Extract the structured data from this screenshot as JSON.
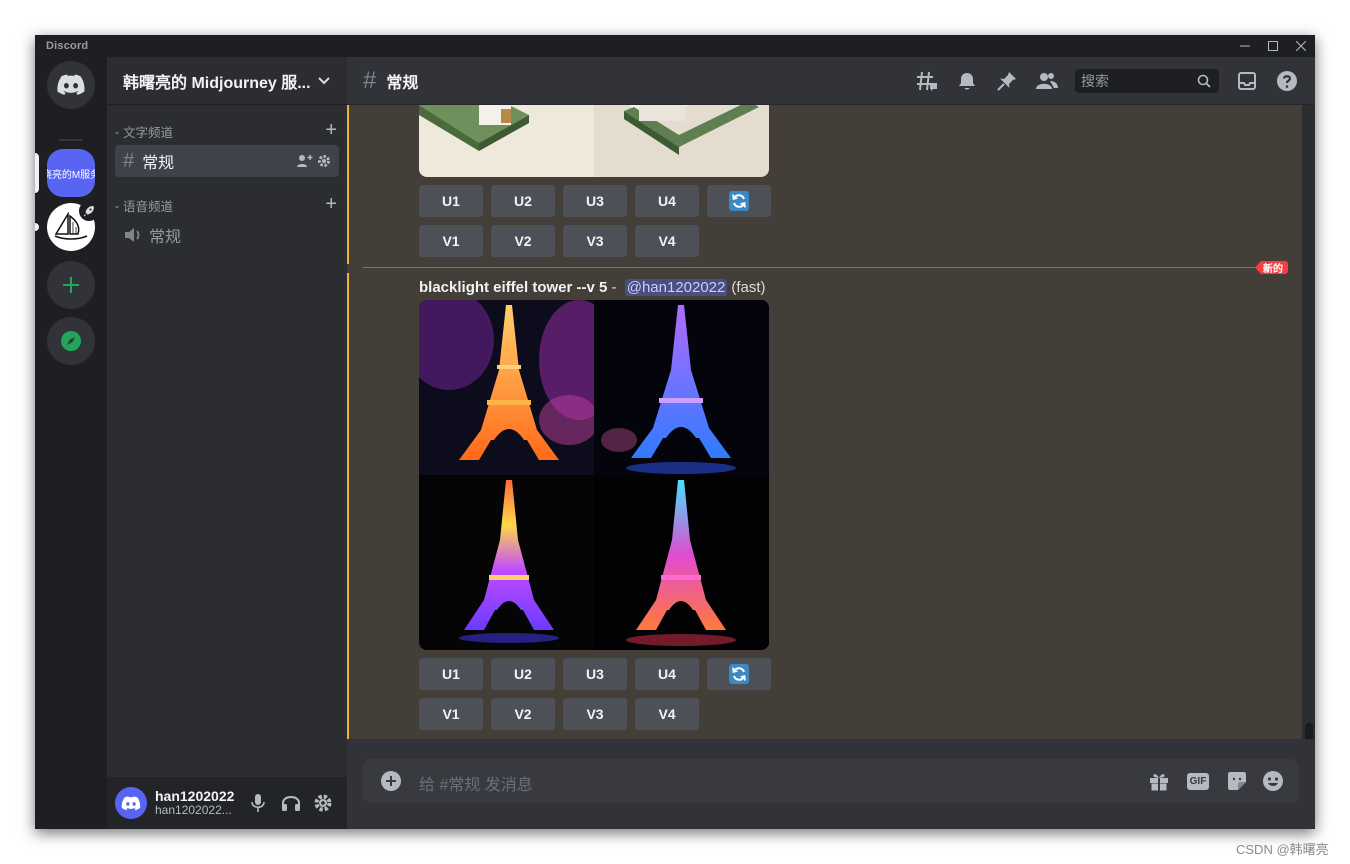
{
  "window": {
    "app_name": "Discord"
  },
  "guilds": {
    "server_label": "晓亮的M服务",
    "colors": {
      "brand": "#5865f2",
      "green": "#23a559"
    }
  },
  "sidebar": {
    "server_name": "韩曙亮的 Midjourney 服...",
    "text_category": "文字频道",
    "voice_category": "语音频道",
    "text_channel": "常规",
    "voice_channel": "常规"
  },
  "user": {
    "name": "han1202022",
    "status": "han1202022..."
  },
  "header": {
    "channel": "常规",
    "search_placeholder": "搜索"
  },
  "messages": {
    "upper_buttons": {
      "row1": [
        "U1",
        "U2",
        "U3",
        "U4"
      ],
      "row2": [
        "V1",
        "V2",
        "V3",
        "V4"
      ]
    },
    "new_divider": "新的",
    "prompt": "blacklight eiffel tower --v 5",
    "separator": " - ",
    "mention": "@han1202022",
    "mode": "(fast)",
    "lower_buttons": {
      "row1": [
        "U1",
        "U2",
        "U3",
        "U4"
      ],
      "row2": [
        "V1",
        "V2",
        "V3",
        "V4"
      ]
    }
  },
  "composer": {
    "placeholder": "给 #常规 发消息",
    "gif_label": "GIF"
  },
  "watermark": "CSDN @韩曙亮"
}
